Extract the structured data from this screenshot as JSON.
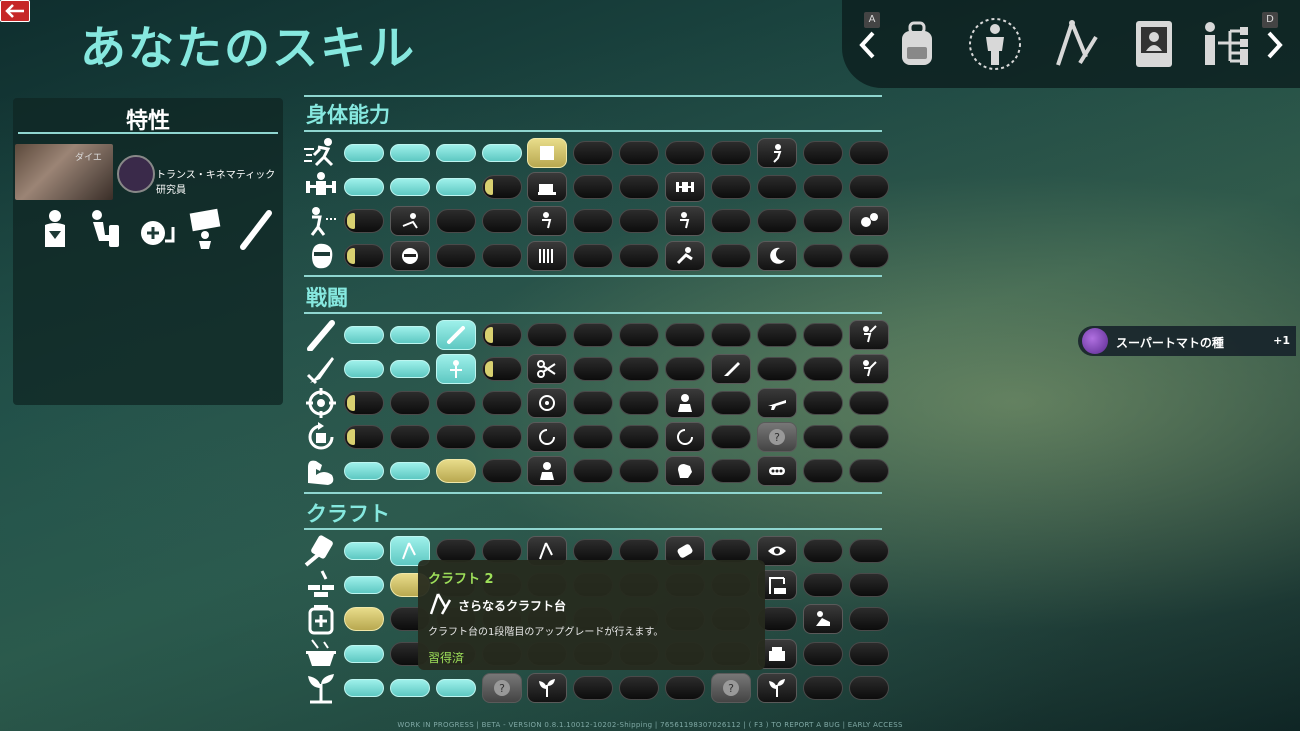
{
  "page_title": "あなたのスキル",
  "top_nav": {
    "left_key": "A",
    "right_key": "D",
    "icons": [
      "backpack-icon",
      "body-icon",
      "crafting-compass-icon",
      "journal-icon",
      "skills-tree-icon"
    ]
  },
  "traits": {
    "title": "特性",
    "card_label": "ダイエ",
    "card_name": "トランス・キネマティック研究員",
    "icons": [
      "cold-shiver-icon",
      "toilet-icon",
      "snail-plus-icon",
      "sign-carrier-icon",
      "bat-icon"
    ]
  },
  "sections": [
    {
      "id": "physical",
      "title": "身体能力"
    },
    {
      "id": "combat",
      "title": "戦闘"
    },
    {
      "id": "craft",
      "title": "クラフト"
    }
  ],
  "tooltip": {
    "title": "クラフト 2",
    "name": "さらなるクラフト台",
    "description": "クラフト台の1段階目のアップグレードが行えます。",
    "status": "習得済"
  },
  "notification": {
    "text": "スーパートマトの種",
    "count": "+1"
  },
  "footer": "WORK IN PROGRESS | BETA - VERSION 0.8.1.10012-10202-Shipping | 76561198307026112 | ( F3 ) TO REPORT A BUG | EARLY ACCESS",
  "colors": {
    "accent": "#86e8df",
    "done": "#5ec8c2",
    "progress": "#d8d070",
    "tooltip_green": "#9ee05a",
    "back": "#c62828"
  }
}
